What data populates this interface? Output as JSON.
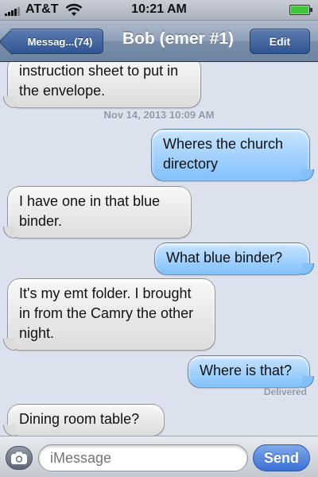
{
  "status_bar": {
    "carrier": "AT&T",
    "time": "10:21 AM",
    "battery_level": 0.9,
    "signal_icon": "signal-bars-icon",
    "wifi_icon": "wifi-icon",
    "battery_icon": "battery-icon"
  },
  "nav": {
    "back_label": "Messag...(74)",
    "title": "Bob (emer #1)",
    "edit_label": "Edit"
  },
  "messages": [
    {
      "direction": "in",
      "text": "instruction sheet to put in the envelope."
    },
    {
      "type": "timestamp",
      "text": "Nov 14, 2013 10:09 AM"
    },
    {
      "direction": "out",
      "text": "Wheres the church directory"
    },
    {
      "direction": "in",
      "text": "I have one in that blue binder."
    },
    {
      "direction": "out",
      "text": "What blue binder?"
    },
    {
      "direction": "in",
      "text": "It's my emt folder. I brought in from the Camry the other night."
    },
    {
      "direction": "out",
      "text": "Where is that?"
    },
    {
      "type": "status",
      "text": "Delivered"
    },
    {
      "direction": "in",
      "text": "Dining room table?"
    }
  ],
  "input": {
    "placeholder": "iMessage",
    "send_label": "Send",
    "camera_icon": "camera-icon"
  },
  "colors": {
    "incoming_bubble": "#e6e6e6",
    "outgoing_bubble": "#a6d3fd",
    "nav_bar": "#8d9fb8",
    "send_button": "#3b6fd3",
    "background": "#dbe2ed"
  }
}
